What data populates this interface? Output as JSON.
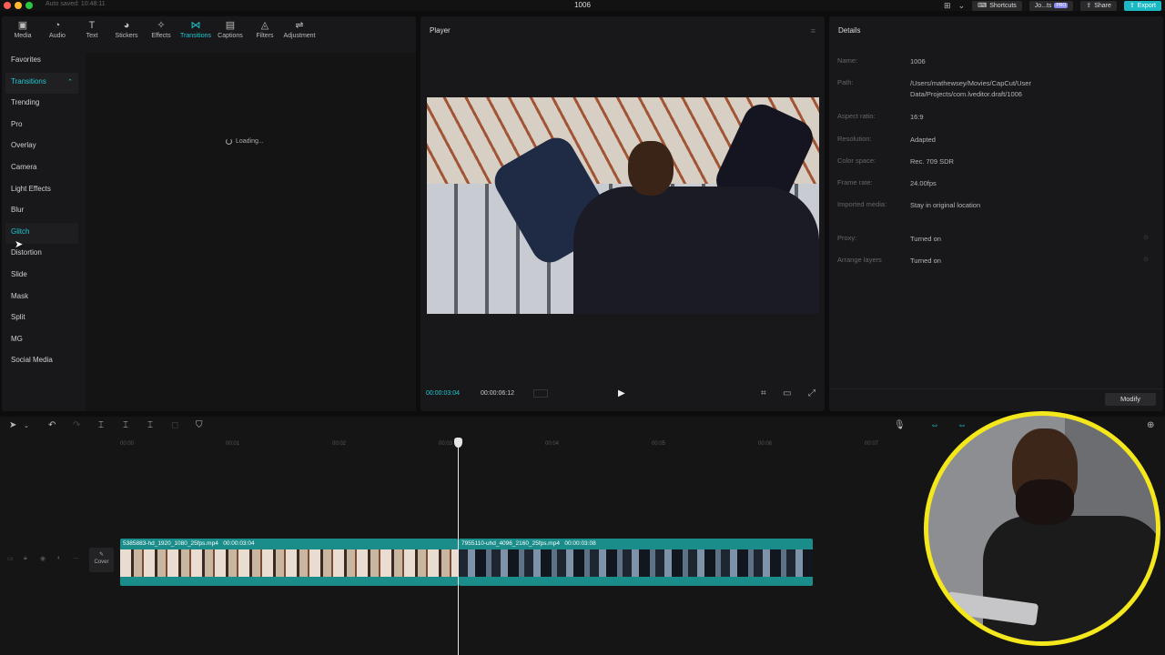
{
  "titlebar": {
    "autosave": "Auto saved: 10:48:11",
    "project_title": "1006",
    "shortcuts_label": "Shortcuts",
    "user_label": "Jo...ts",
    "pro_badge": "PRO",
    "share_label": "Share",
    "export_label": "Export",
    "dot_colors": [
      "#ff5f57",
      "#febc2e",
      "#28c840"
    ]
  },
  "toolbar": {
    "tools": [
      {
        "label": "Media",
        "icon": "▣"
      },
      {
        "label": "Audio",
        "icon": "◔"
      },
      {
        "label": "Text",
        "icon": "T"
      },
      {
        "label": "Stickers",
        "icon": "◕"
      },
      {
        "label": "Effects",
        "icon": "✧"
      },
      {
        "label": "Transitions",
        "icon": "⋈"
      },
      {
        "label": "Captions",
        "icon": "▤"
      },
      {
        "label": "Filters",
        "icon": "◬"
      },
      {
        "label": "Adjustment",
        "icon": "⇌"
      }
    ],
    "active": "Transitions"
  },
  "categories": [
    "Favorites",
    "Transitions",
    "Trending",
    "Pro",
    "Overlay",
    "Camera",
    "Light Effects",
    "Blur",
    "Glitch",
    "Distortion",
    "Slide",
    "Mask",
    "Split",
    "MG",
    "Social Media"
  ],
  "loading_text": "Loading...",
  "player": {
    "title": "Player",
    "current_time": "00:00:03:04",
    "total_time": "00:00:06:12"
  },
  "details": {
    "title": "Details",
    "rows": [
      {
        "label": "Name:",
        "value": "1006"
      },
      {
        "label": "Path:",
        "value": "/Users/mathewsey/Movies/CapCut/User Data/Projects/com.lveditor.draft/1006"
      },
      {
        "label": "Aspect ratio:",
        "value": "16:9"
      },
      {
        "label": "Resolution:",
        "value": "Adapted"
      },
      {
        "label": "Color space:",
        "value": "Rec. 709 SDR"
      },
      {
        "label": "Frame rate:",
        "value": "24.00fps"
      },
      {
        "label": "Imported media:",
        "value": "Stay in original location"
      },
      {
        "label": "Proxy:",
        "value": "Turned on"
      },
      {
        "label": "Arrange layers",
        "value": "Turned on"
      }
    ],
    "modify_label": "Modify"
  },
  "timeline": {
    "ticks": [
      "00:00",
      "00:01",
      "00:02",
      "00:03",
      "00:04",
      "00:05",
      "00:06",
      "00:07"
    ],
    "cover_label": "Cover",
    "clips": [
      {
        "name": "5385883-hd_1920_1080_25fps.mp4",
        "duration": "00:00:03:04"
      },
      {
        "name": "7955110-uhd_4096_2160_25fps.mp4",
        "duration": "00:00:03:08"
      }
    ]
  },
  "accent_color": "#1ec8d3"
}
